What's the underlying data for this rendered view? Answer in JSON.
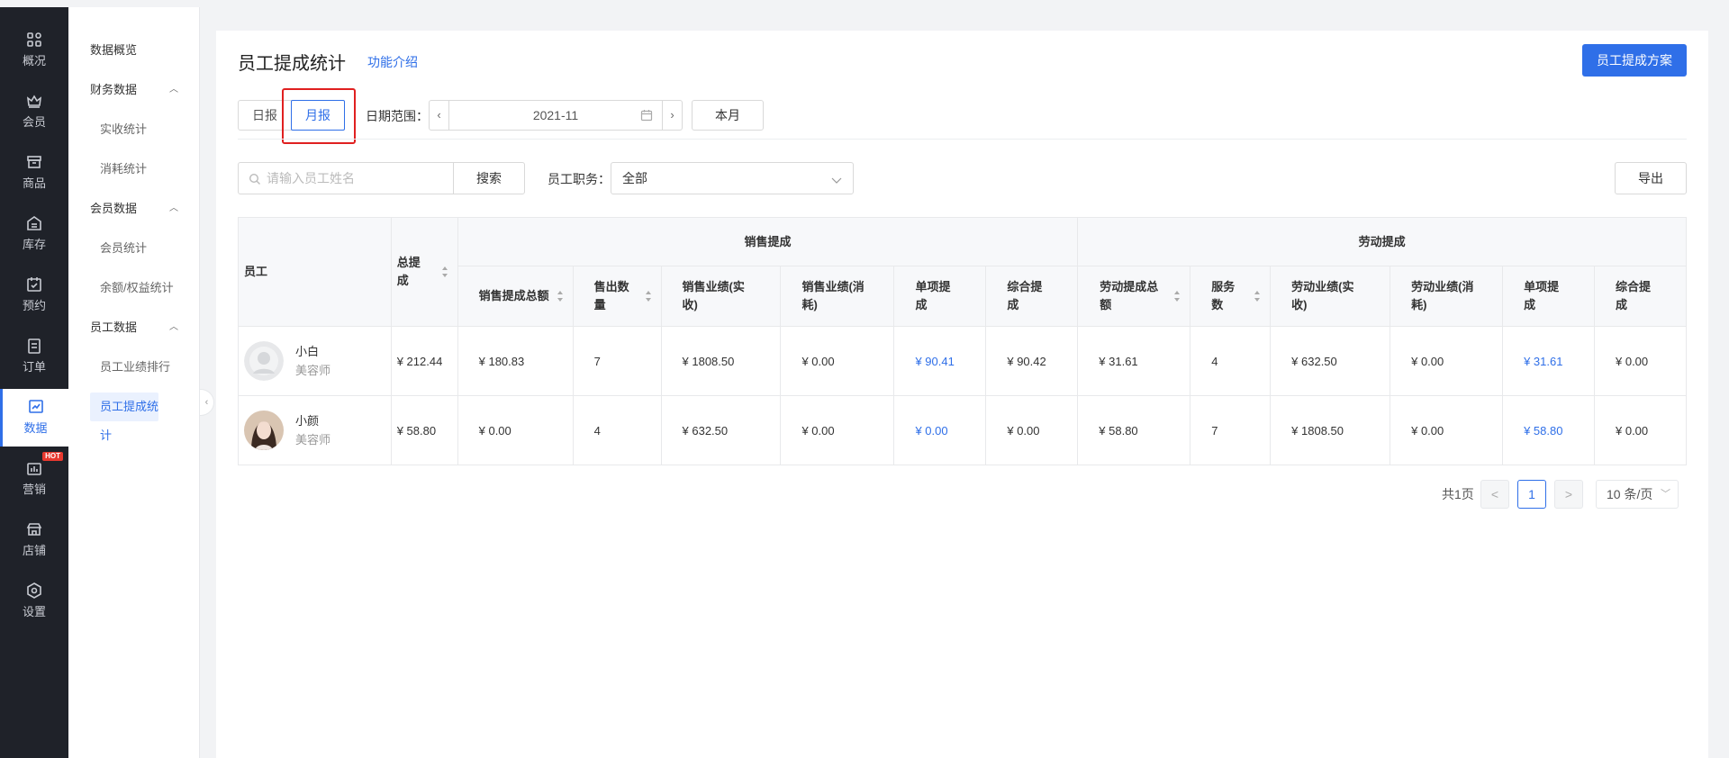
{
  "nav": [
    {
      "label": "概况",
      "icon": "grid-icon"
    },
    {
      "label": "会员",
      "icon": "crown-icon"
    },
    {
      "label": "商品",
      "icon": "box-icon"
    },
    {
      "label": "库存",
      "icon": "warehouse-icon"
    },
    {
      "label": "预约",
      "icon": "calendar-check-icon"
    },
    {
      "label": "订单",
      "icon": "clipboard-icon"
    },
    {
      "label": "数据",
      "icon": "chart-icon"
    },
    {
      "label": "营销",
      "icon": "marketing-icon",
      "badge": "HOT"
    },
    {
      "label": "店铺",
      "icon": "store-icon"
    },
    {
      "label": "设置",
      "icon": "settings-icon"
    }
  ],
  "submenu": {
    "overview": "数据概览",
    "finance": "财务数据",
    "finance_items": [
      "实收统计",
      "消耗统计"
    ],
    "member": "会员数据",
    "member_items": [
      "会员统计",
      "余额/权益统计"
    ],
    "staff": "员工数据",
    "staff_items": [
      "员工业绩排行",
      "员工提成统计"
    ]
  },
  "page": {
    "title": "员工提成统计",
    "intro_link": "功能介绍",
    "plan_button": "员工提成方案",
    "tab_day": "日报",
    "tab_month": "月报",
    "date_label": "日期范围：",
    "date_value": "2021-11",
    "this_month": "本月",
    "search_placeholder": "请输入员工姓名",
    "search_button": "搜索",
    "role_label": "员工职务：",
    "role_value": "全部",
    "export_button": "导出"
  },
  "table": {
    "h_employee": "员工",
    "h_total": "总提成",
    "group_sales": "销售提成",
    "group_labor": "劳动提成",
    "sales_cols": [
      "销售提成总额",
      "售出数量",
      "销售业绩(实收)",
      "销售业绩(消耗)",
      "单项提成",
      "综合提成"
    ],
    "labor_cols": [
      "劳动提成总额",
      "服务数",
      "劳动业绩(实收)",
      "劳动业绩(消耗)",
      "单项提成",
      "综合提成"
    ],
    "rows": [
      {
        "name": "小白",
        "role": "美容师",
        "total": "¥ 212.44",
        "sales": [
          "¥ 180.83",
          "7",
          "¥ 1808.50",
          "¥ 0.00",
          "¥ 90.41",
          "¥ 90.42"
        ],
        "labor": [
          "¥ 31.61",
          "4",
          "¥ 632.50",
          "¥ 0.00",
          "¥ 31.61",
          "¥ 0.00"
        ]
      },
      {
        "name": "小颜",
        "role": "美容师",
        "total": "¥ 58.80",
        "sales": [
          "¥ 0.00",
          "4",
          "¥ 632.50",
          "¥ 0.00",
          "¥ 0.00",
          "¥ 0.00"
        ],
        "labor": [
          "¥ 58.80",
          "7",
          "¥ 1808.50",
          "¥ 0.00",
          "¥ 58.80",
          "¥ 0.00"
        ]
      }
    ]
  },
  "pagination": {
    "total_text": "共1页",
    "prev": "<",
    "current": "1",
    "next": ">",
    "page_size": "10 条/页"
  },
  "colors": {
    "accent": "#2f6fe8",
    "nav_bg": "#1f2229",
    "highlight": "#e02020"
  }
}
